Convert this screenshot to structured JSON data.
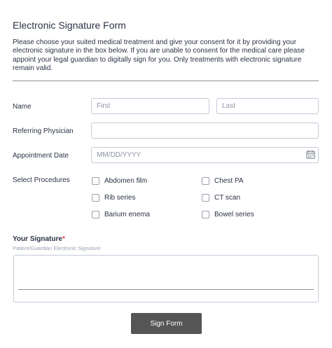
{
  "form": {
    "title": "Electronic Signature Form",
    "description": "Please choose your suited medical treatment and give your consent for it by providing your electronic signature in the box below. If you are unable to consent for the medical care please appoint your legal guardian to digitally sign for you. Only treatments with electronic signature remain valid."
  },
  "name": {
    "label": "Name",
    "first": {
      "placeholder": "First",
      "value": ""
    },
    "last": {
      "placeholder": "Last",
      "value": ""
    }
  },
  "physician": {
    "label": "Referring Physician",
    "value": ""
  },
  "appointment": {
    "label": "Appointment Date",
    "placeholder": "MM/DD/YYYY",
    "icon": "calendar-icon"
  },
  "procedures": {
    "label": "Select Procedures",
    "options": [
      {
        "label": "Abdomen film",
        "checked": false
      },
      {
        "label": "Chest PA",
        "checked": false
      },
      {
        "label": "Rib series",
        "checked": false
      },
      {
        "label": "CT scan",
        "checked": false
      },
      {
        "label": "Barium enema",
        "checked": false
      },
      {
        "label": "Bowel series",
        "checked": false
      }
    ]
  },
  "signature": {
    "label": "Your Signature",
    "required_mark": "*",
    "sublabel": "Patient/Guardian Electronic Signature"
  },
  "submit": {
    "label": "Sign Form"
  },
  "colors": {
    "button": "#555555",
    "required": "#e03e3e",
    "border": "#c3cad8",
    "text": "#2b3245"
  }
}
